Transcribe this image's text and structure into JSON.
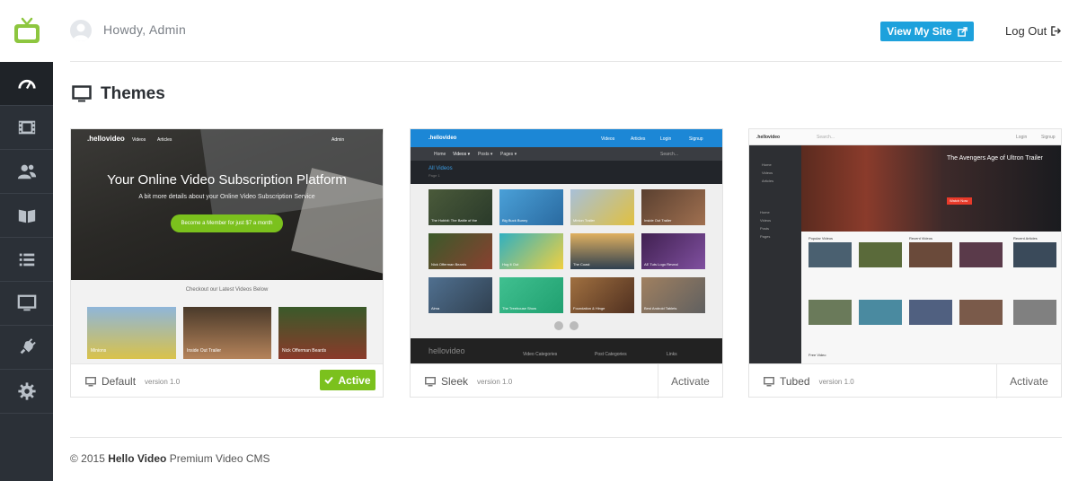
{
  "header": {
    "greeting": "Howdy, Admin",
    "view_site": "View My Site",
    "logout": "Log Out"
  },
  "sidebar": {
    "items": [
      {
        "icon": "dashboard-icon"
      },
      {
        "icon": "film-icon"
      },
      {
        "icon": "users-icon"
      },
      {
        "icon": "book-icon"
      },
      {
        "icon": "list-icon"
      },
      {
        "icon": "monitor-icon"
      },
      {
        "icon": "plug-icon"
      },
      {
        "icon": "gear-icon"
      }
    ]
  },
  "page": {
    "title": "Themes"
  },
  "themes": [
    {
      "name": "Default",
      "version": "version 1.0",
      "action": "Active",
      "preview": {
        "logo": ".hellovideo",
        "nav_videos": "Videos",
        "nav_articles": "Articles",
        "nav_admin": "Admin",
        "hero_title": "Your Online Video Subscription Platform",
        "hero_sub": "A bit more details about your Online Video Subscription Service",
        "hero_button": "Become a Member for just $7 a month",
        "latest": "Checkout our Latest Videos Below",
        "thumbs": [
          "Minions",
          "Inside Out Trailer",
          "Nick Offerman Beards"
        ]
      }
    },
    {
      "name": "Sleek",
      "version": "version 1.0",
      "action": "Activate",
      "preview": {
        "logo": ".hellovideo",
        "nav": [
          "Videos",
          "Articles",
          "Login",
          "Signup"
        ],
        "subnav": [
          "Home",
          "Videos ▾",
          "Posts ▾",
          "Pages ▾"
        ],
        "search": "Search...",
        "section": "All Videos",
        "page": "Page 1",
        "thumbs": [
          "The Hobbit: The Battle of the",
          "Big Buck Bunny",
          "Minion Trailer",
          "Inside Out Trailer",
          "Nick Offerman Beards",
          "Hug It Out",
          "The Coast",
          "AE Tuts Logo Reveal",
          "Alma",
          "The Treehouse Show",
          "Foundation & Hinge",
          "Best Android Tablets"
        ],
        "footer_logo": "hellovideo",
        "footer_links": [
          "Video Categories",
          "Post Categories",
          "Links"
        ]
      }
    },
    {
      "name": "Tubed",
      "version": "version 1.0",
      "action": "Activate",
      "preview": {
        "logo": ".hellovideo",
        "search": "Search...",
        "login": "Login",
        "signup": "Signup",
        "hero_title": "The Avengers Age of Ultron Trailer",
        "hero_button": "Watch Now",
        "side_groups": [
          "Home",
          "Videos",
          "Articles",
          "Home",
          "Videos",
          "Posts",
          "Pages"
        ],
        "popular": "Popular Videos",
        "recent": "Recent Videos",
        "articles": "Recent Articles",
        "free_video": "Free Video"
      }
    }
  ],
  "footer": {
    "copyright": "© 2015",
    "brand": "Hello Video",
    "tagline": "Premium Video CMS"
  },
  "colors": {
    "sidebar_bg": "#2b3037",
    "accent_blue": "#1da1dc",
    "active_green": "#7bc11d",
    "logo_green": "#8dc63f"
  }
}
